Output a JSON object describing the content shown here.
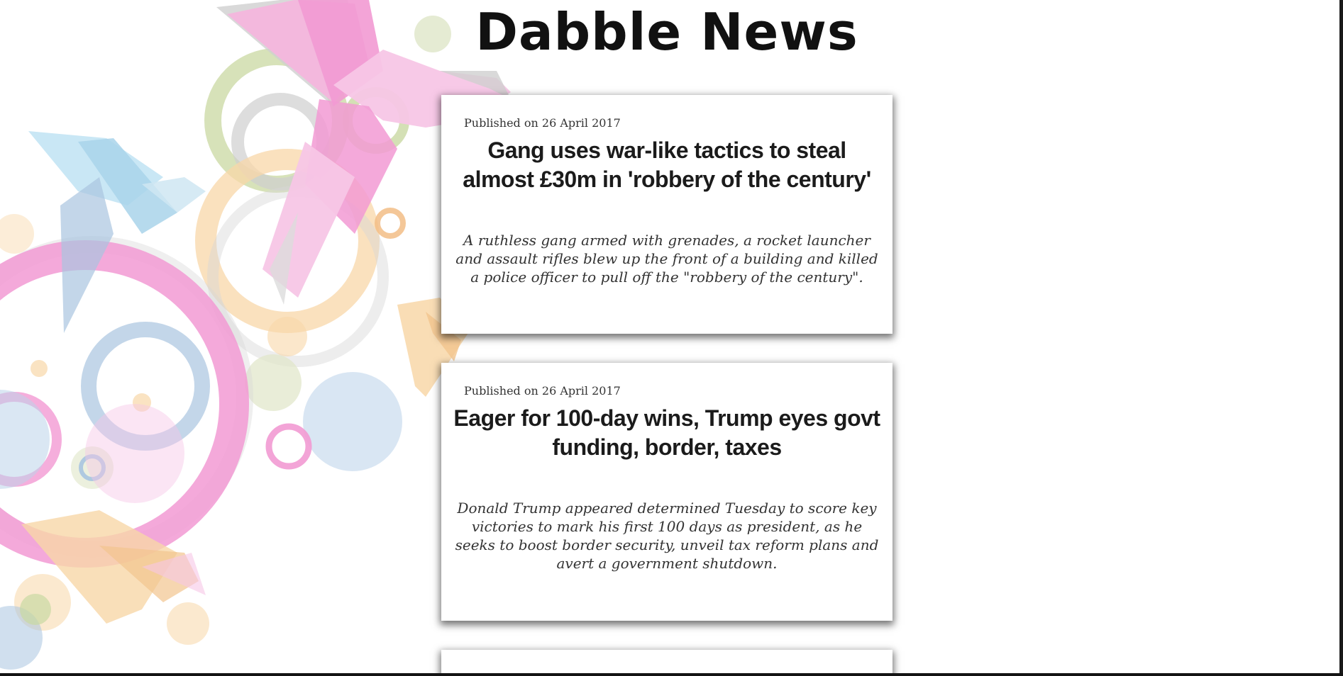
{
  "site": {
    "title": "Dabble News"
  },
  "articles": [
    {
      "published": "Published on 26 April 2017",
      "headline": "Gang uses war-like tactics to steal almost £30m in 'robbery of the century'",
      "summary": "A ruthless gang armed with grenades, a rocket launcher and assault rifles blew up the front of a building and killed a police officer to pull off the \"robbery of the century\"."
    },
    {
      "published": "Published on 26 April 2017",
      "headline": "Eager for 100-day wins, Trump eyes govt funding, border, taxes",
      "summary": "Donald Trump appeared determined Tuesday to score key victories to mark his first 100 days as president, as he seeks to boost border security, unveil tax reform plans and avert a government shutdown."
    }
  ],
  "background": {
    "illustration": "origami-birds-and-rings",
    "colors": {
      "pink": "#f29ad3",
      "light_pink": "#f7c6e6",
      "blue": "#a9d4ea",
      "green": "#c9d8a2",
      "orange": "#f8d7a8",
      "gray": "#cfcfcf"
    }
  }
}
